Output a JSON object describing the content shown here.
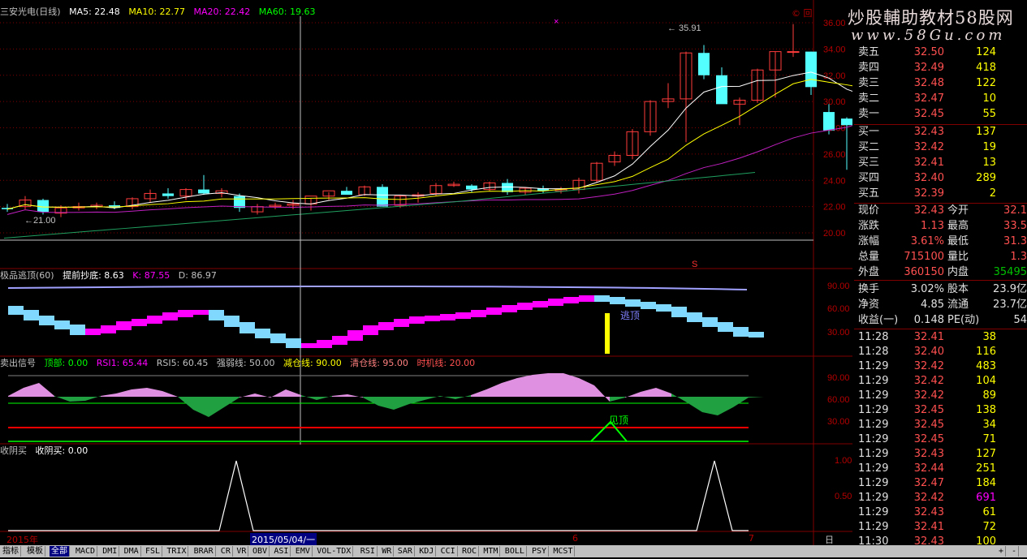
{
  "header": {
    "title": "三安光电(日线)",
    "ma5": "MA5: 22.48",
    "ma10": "MA10: 22.77",
    "ma20": "MA20: 22.42",
    "ma60": "MA60: 19.63",
    "corner_icon": "©",
    "corner_icon2": "回"
  },
  "colors": {
    "up": "#ff3c3c",
    "down": "#54ffff",
    "ma5": "#ffffff",
    "ma10": "#ffff00",
    "ma20": "#ff00ff",
    "ma60": "#00ff00",
    "grid": "#800000"
  },
  "price_axis": [
    "36.00",
    "34.00",
    "32.00",
    "30.00",
    "28.00",
    "26.00",
    "24.00",
    "22.00",
    "20.00"
  ],
  "price_annotations": {
    "high": "35.91",
    "low": "21.00",
    "s_marker": "S"
  },
  "panel2": {
    "title": "极品逃顶(60)",
    "early": "提前抄底: 8.63",
    "k": "K: 87.55",
    "d": "D: 86.97",
    "axis": [
      "90.00",
      "60.00",
      "30.00"
    ],
    "tag": "逃顶"
  },
  "panel3": {
    "title": "卖出信号",
    "top": "顶部: 0.00",
    "rsi1": "RSI1: 65.44",
    "rsi5": "RSI5: 60.45",
    "strong": "强弱线: 50.00",
    "reduce": "减仓线: 90.00",
    "clear": "清仓线: 95.00",
    "timing": "时机线: 20.00",
    "axis": [
      "90.00",
      "60.00",
      "30.00"
    ],
    "tag": "见顶"
  },
  "panel4": {
    "title": "收阴买",
    "value": "收阴买: 0.00",
    "axis": [
      "1.00",
      "0.50"
    ]
  },
  "date_axis": {
    "start": "2015年",
    "cursor": "2015/05/04/一",
    "m6": "6",
    "m7": "7",
    "period": "日线"
  },
  "watermark": {
    "line1": "炒股輔助教材58股网",
    "line2": "www.58Gu.com"
  },
  "orderbook": {
    "asks": [
      {
        "label": "卖五",
        "price": "32.50",
        "vol": "124"
      },
      {
        "label": "卖四",
        "price": "32.49",
        "vol": "418"
      },
      {
        "label": "卖三",
        "price": "32.48",
        "vol": "122"
      },
      {
        "label": "卖二",
        "price": "32.47",
        "vol": "10"
      },
      {
        "label": "卖一",
        "price": "32.45",
        "vol": "55"
      }
    ],
    "bids": [
      {
        "label": "买一",
        "price": "32.43",
        "vol": "137"
      },
      {
        "label": "买二",
        "price": "32.42",
        "vol": "19"
      },
      {
        "label": "买三",
        "price": "32.41",
        "vol": "13"
      },
      {
        "label": "买四",
        "price": "32.40",
        "vol": "289"
      },
      {
        "label": "买五",
        "price": "32.39",
        "vol": "2"
      }
    ]
  },
  "stats": [
    {
      "l1": "现价",
      "v1": "32.43",
      "l2": "今开",
      "v2": "32.1"
    },
    {
      "l1": "涨跌",
      "v1": "1.13",
      "l2": "最高",
      "v2": "33.5"
    },
    {
      "l1": "涨幅",
      "v1": "3.61%",
      "l2": "最低",
      "v2": "31.3"
    },
    {
      "l1": "总量",
      "v1": "715100",
      "l2": "量比",
      "v2": "1.3"
    },
    {
      "l1": "外盘",
      "v1": "360150",
      "l2": "内盘",
      "v2": "35495"
    }
  ],
  "stats2": [
    {
      "l1": "换手",
      "v1": "3.02%",
      "l2": "股本",
      "v2": "23.9亿"
    },
    {
      "l1": "净资",
      "v1": "4.85",
      "l2": "流通",
      "v2": "23.7亿"
    },
    {
      "l1": "收益(一)",
      "v1": "0.148",
      "l2": "PE(动)",
      "v2": "54"
    }
  ],
  "ticks": [
    {
      "t": "11:28",
      "p": "32.41",
      "v": "38"
    },
    {
      "t": "11:28",
      "p": "32.40",
      "v": "116"
    },
    {
      "t": "11:29",
      "p": "32.42",
      "v": "483"
    },
    {
      "t": "11:29",
      "p": "32.42",
      "v": "104"
    },
    {
      "t": "11:29",
      "p": "32.42",
      "v": "89"
    },
    {
      "t": "11:29",
      "p": "32.45",
      "v": "138"
    },
    {
      "t": "11:29",
      "p": "32.45",
      "v": "34"
    },
    {
      "t": "11:29",
      "p": "32.45",
      "v": "71"
    },
    {
      "t": "11:29",
      "p": "32.43",
      "v": "127"
    },
    {
      "t": "11:29",
      "p": "32.44",
      "v": "251"
    },
    {
      "t": "11:29",
      "p": "32.47",
      "v": "184"
    },
    {
      "t": "11:29",
      "p": "32.42",
      "v": "691"
    },
    {
      "t": "11:29",
      "p": "32.43",
      "v": "61"
    },
    {
      "t": "11:29",
      "p": "32.41",
      "v": "72"
    },
    {
      "t": "11:30",
      "p": "32.43",
      "v": "100"
    }
  ],
  "tabs": [
    "指标",
    "模板",
    "全部",
    "MACD",
    "DMI",
    "DMA",
    "FSL",
    "TRIX",
    "BRAR",
    "CR",
    "VR",
    "OBV",
    "ASI",
    "EMV",
    "VOL-TDX",
    "RSI",
    "WR",
    "SAR",
    "KDJ",
    "CCI",
    "ROC",
    "MTM",
    "BOLL",
    "PSY",
    "MCST"
  ],
  "active_tab": "全部",
  "nav": [
    "+",
    "-"
  ],
  "chart_data": {
    "type": "candlestick",
    "candles": [
      [
        21.9,
        22.2,
        21.6,
        21.8
      ],
      [
        22.0,
        22.8,
        21.8,
        22.5
      ],
      [
        22.5,
        22.6,
        21.4,
        21.6
      ],
      [
        21.5,
        22.1,
        21.2,
        21.9
      ],
      [
        21.9,
        22.3,
        21.7,
        22.0
      ],
      [
        22.0,
        22.3,
        21.8,
        22.1
      ],
      [
        22.1,
        22.4,
        21.8,
        21.9
      ],
      [
        22.0,
        22.7,
        21.8,
        22.6
      ],
      [
        22.6,
        23.3,
        22.3,
        23.0
      ],
      [
        23.0,
        23.4,
        22.6,
        22.8
      ],
      [
        22.8,
        23.4,
        22.5,
        23.3
      ],
      [
        23.3,
        24.4,
        22.9,
        23.0
      ],
      [
        23.0,
        23.4,
        22.7,
        23.2
      ],
      [
        22.8,
        23.0,
        21.6,
        21.9
      ],
      [
        21.6,
        22.2,
        21.4,
        22.0
      ],
      [
        22.0,
        22.3,
        21.8,
        22.1
      ],
      [
        22.1,
        22.5,
        21.8,
        22.2
      ],
      [
        22.2,
        22.6,
        21.7,
        22.8
      ],
      [
        22.8,
        23.1,
        22.5,
        23.2
      ],
      [
        23.2,
        23.5,
        22.9,
        22.9
      ],
      [
        22.9,
        23.6,
        22.8,
        23.5
      ],
      [
        23.5,
        23.7,
        22.0,
        22.0
      ],
      [
        22.1,
        22.9,
        21.9,
        22.8
      ],
      [
        22.8,
        23.1,
        22.3,
        22.9
      ],
      [
        23.0,
        23.8,
        22.8,
        23.6
      ],
      [
        23.6,
        23.9,
        23.5,
        23.7
      ],
      [
        23.6,
        23.7,
        23.1,
        23.3
      ],
      [
        23.3,
        23.9,
        23.2,
        23.8
      ],
      [
        23.8,
        24.1,
        22.9,
        23.1
      ],
      [
        23.1,
        23.4,
        22.9,
        23.4
      ],
      [
        23.4,
        23.6,
        23.0,
        23.2
      ],
      [
        23.2,
        23.5,
        23.0,
        23.3
      ],
      [
        23.3,
        24.2,
        23.0,
        24.0
      ],
      [
        24.0,
        25.4,
        23.8,
        25.3
      ],
      [
        25.4,
        26.2,
        25.1,
        25.9
      ],
      [
        25.9,
        27.9,
        25.6,
        27.7
      ],
      [
        27.7,
        30.1,
        27.4,
        30.0
      ],
      [
        30.0,
        31.4,
        29.5,
        30.2
      ],
      [
        30.2,
        33.8,
        26.9,
        33.7
      ],
      [
        33.7,
        34.3,
        31.7,
        32.0
      ],
      [
        32.0,
        32.6,
        30.1,
        29.8
      ],
      [
        29.8,
        30.3,
        28.2,
        30.1
      ],
      [
        30.1,
        32.5,
        29.9,
        32.4
      ],
      [
        32.4,
        33.8,
        30.3,
        33.8
      ],
      [
        33.8,
        35.9,
        33.4,
        33.8
      ],
      [
        33.8,
        33.8,
        30.5,
        31.1
      ],
      [
        29.2,
        29.8,
        27.5,
        27.8
      ],
      [
        28.7,
        28.8,
        24.8,
        28.2
      ],
      [
        28.3,
        31.4,
        26.4,
        31.3
      ],
      [
        31.3,
        33.5,
        31.2,
        32.4
      ]
    ],
    "ylim": [
      19.5,
      36.6
    ]
  }
}
